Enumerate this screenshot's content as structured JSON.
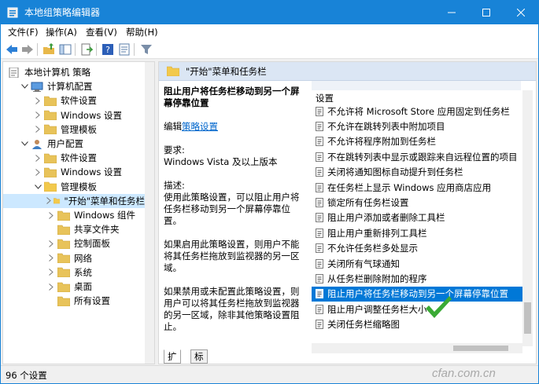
{
  "window": {
    "title": "本地组策略编辑器"
  },
  "menu": [
    "文件(F)",
    "操作(A)",
    "查看(V)",
    "帮助(H)"
  ],
  "toolbar": {
    "icons": [
      "back-icon",
      "forward-icon",
      "up-folder-icon",
      "show-hide-tree-icon",
      "export-list-icon",
      "help-icon",
      "properties-icon",
      "filter-icon"
    ]
  },
  "tree": {
    "items": [
      {
        "label": "本地计算机 策略",
        "level": 0,
        "expanded": true,
        "icon": "computer-policy-icon"
      },
      {
        "label": "计算机配置",
        "level": 1,
        "expanded": true,
        "icon": "computer-icon"
      },
      {
        "label": "软件设置",
        "level": 2,
        "expanded": false,
        "icon": "folder-icon"
      },
      {
        "label": "Windows 设置",
        "level": 2,
        "expanded": false,
        "icon": "folder-icon"
      },
      {
        "label": "管理模板",
        "level": 2,
        "expanded": false,
        "icon": "folder-icon"
      },
      {
        "label": "用户配置",
        "level": 1,
        "expanded": true,
        "icon": "user-icon"
      },
      {
        "label": "软件设置",
        "level": 2,
        "expanded": false,
        "icon": "folder-icon"
      },
      {
        "label": "Windows 设置",
        "level": 2,
        "expanded": false,
        "icon": "folder-icon"
      },
      {
        "label": "管理模板",
        "level": 2,
        "expanded": true,
        "icon": "folder-open-icon"
      },
      {
        "label": "\"开始\"菜单和任务栏",
        "level": 3,
        "expanded": false,
        "icon": "folder-open-icon",
        "selected": true
      },
      {
        "label": "Windows 组件",
        "level": 3,
        "expanded": false,
        "icon": "folder-icon"
      },
      {
        "label": "共享文件夹",
        "level": 3,
        "leaf": true,
        "icon": "folder-icon"
      },
      {
        "label": "控制面板",
        "level": 3,
        "expanded": false,
        "icon": "folder-icon"
      },
      {
        "label": "网络",
        "level": 3,
        "expanded": false,
        "icon": "folder-icon"
      },
      {
        "label": "系统",
        "level": 3,
        "expanded": false,
        "icon": "folder-icon"
      },
      {
        "label": "桌面",
        "level": 3,
        "expanded": false,
        "icon": "folder-icon"
      },
      {
        "label": "所有设置",
        "level": 3,
        "leaf": true,
        "icon": "folder-icon"
      }
    ]
  },
  "right": {
    "header": "\"开始\"菜单和任务栏",
    "description": {
      "title": "阻止用户将任务栏移动到另一个屏幕停靠位置",
      "edit_prefix": "编辑",
      "edit_link": "策略设置",
      "requirements_label": "要求:",
      "requirements_value": "Windows Vista 及以上版本",
      "desc_label": "描述:",
      "desc_text": "使用此策略设置，可以阻止用户将任务栏移动到另一个屏幕停靠位置。",
      "enabled_text": "如果启用此策略设置，则用户不能将其任务栏拖放到监视器的另一区域。",
      "disabled_text": "如果禁用或未配置此策略设置，则用户可以将其任务栏拖放到监视器的另一区域，除非其他策略设置阻止。"
    },
    "list_header": "设置",
    "list": [
      "不允许将 Microsoft Store 应用固定到任务栏",
      "不允许在跳转列表中附加项目",
      "不允许将程序附加到任务栏",
      "不在跳转列表中显示或跟踪来自远程位置的项目",
      "关闭将通知图标自动提升到任务栏",
      "在任务栏上显示 Windows 应用商店应用",
      "锁定所有任务栏设置",
      "阻止用户添加或者删除工具栏",
      "阻止用户重新排列工具栏",
      "不允许任务栏多处显示",
      "关闭所有气球通知",
      "从任务栏删除附加的程序",
      "阻止用户将任务栏移动到另一个屏幕停靠位置",
      "阻止用户调整任务栏大小",
      "关闭任务栏缩略图"
    ],
    "selected_index": 12,
    "tabs": [
      "扩展",
      "标准"
    ]
  },
  "status": {
    "text": "96 个设置"
  },
  "watermark": "cfan.com.cn",
  "colors": {
    "titlebar": "#1883d7",
    "selection": "#0078d7",
    "tree_selection": "#cce8ff",
    "link": "#0066cc",
    "checkmark": "#3aaa35"
  }
}
